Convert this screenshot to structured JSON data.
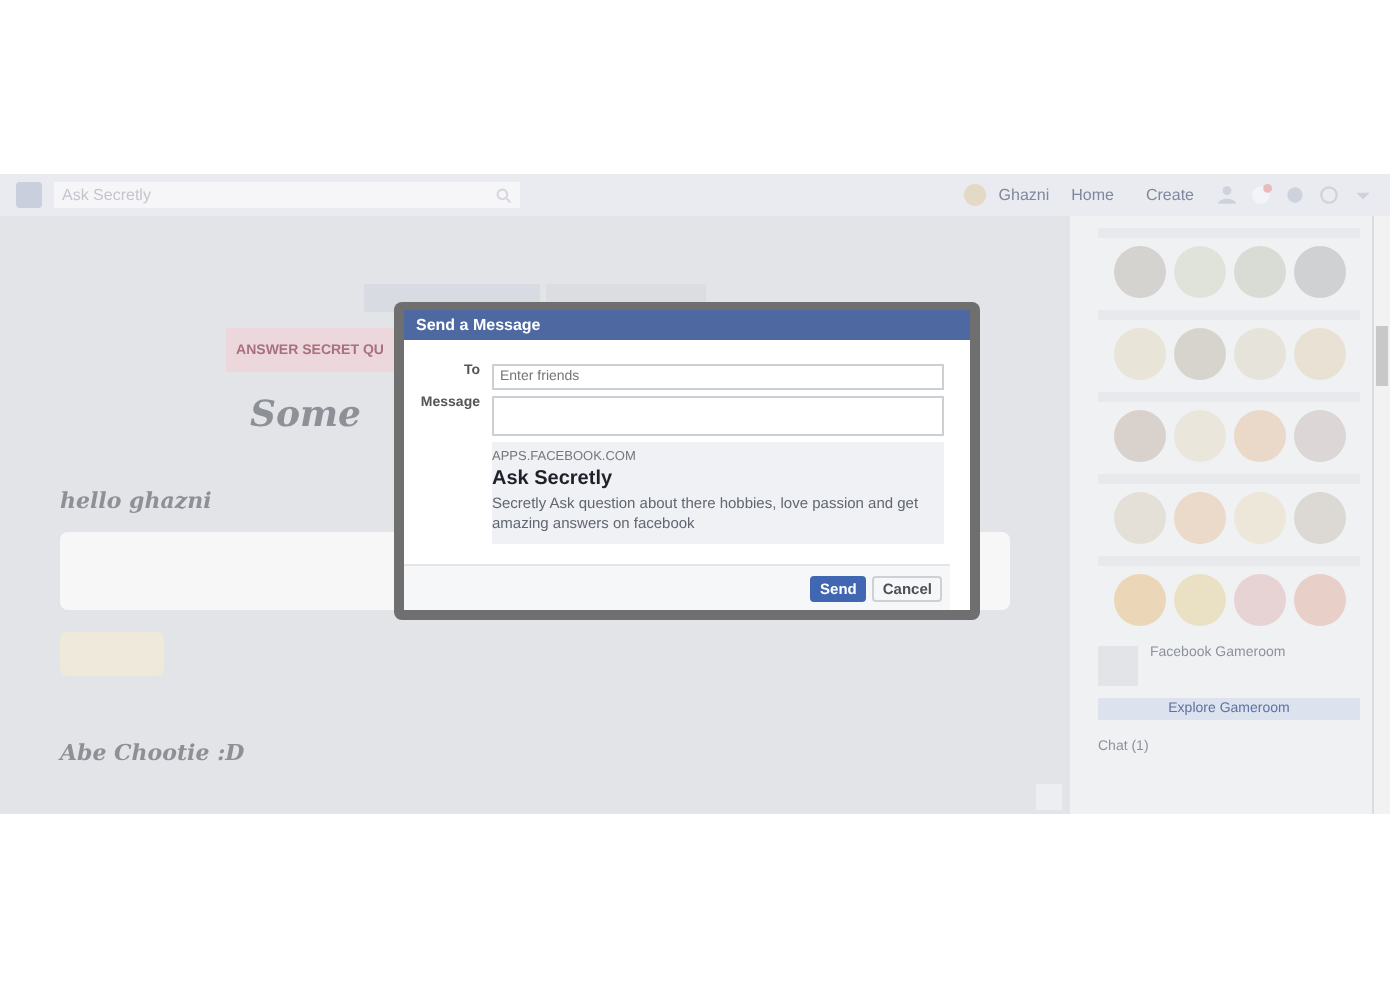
{
  "topbar": {
    "search_value": "Ask Secretly",
    "user": "Ghazni",
    "links": [
      "Home",
      "Create"
    ]
  },
  "main": {
    "answer_button": "ANSWER SECRET QU",
    "heading": "Some",
    "greeting": "hello ghazni",
    "post_author": "Abe Chootie :D"
  },
  "sidebar": {
    "gameroom_title": "Facebook Gameroom",
    "gameroom_button": "Explore Gameroom",
    "chat": "Chat (1)"
  },
  "dialog": {
    "title": "Send a Message",
    "to_label": "To",
    "to_placeholder": "Enter friends",
    "message_label": "Message",
    "preview": {
      "domain": "APPS.FACEBOOK.COM",
      "title": "Ask Secretly",
      "description": "Secretly Ask question about there hobbies, love passion and get amazing answers on facebook"
    },
    "buttons": [
      {
        "label": "Send",
        "kind": "primary"
      },
      {
        "label": "Cancel",
        "kind": "secondary"
      }
    ]
  }
}
